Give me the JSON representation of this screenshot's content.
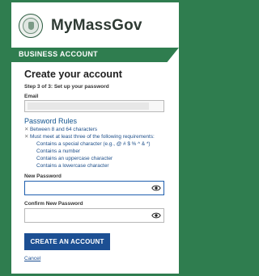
{
  "header": {
    "brand": "MyMassGov",
    "seal_icon": "massachusetts-seal-icon"
  },
  "banner": {
    "label": "BUSINESS ACCOUNT"
  },
  "form": {
    "title": "Create your account",
    "step": "Step 3 of 3: Set up your password",
    "email_label": "Email",
    "email_value": "",
    "rules_title": "Password Rules",
    "rules": [
      "Between 8 and 64 characters",
      "Must meet at least three of the following requirements:"
    ],
    "sub_rules": [
      "Contains a special character (e.g., @ # $ % ^ & *)",
      "Contains a number",
      "Contains an uppercase character",
      "Contains a lowercase character"
    ],
    "new_password_label": "New Password",
    "new_password_value": "",
    "confirm_password_label": "Confirm New Password",
    "confirm_password_value": "",
    "submit_label": "CREATE AN ACCOUNT",
    "cancel_label": "Cancel"
  },
  "colors": {
    "page_bg": "#2f7d4f",
    "accent": "#1c4f93",
    "rule_text": "#1e4f8a"
  }
}
